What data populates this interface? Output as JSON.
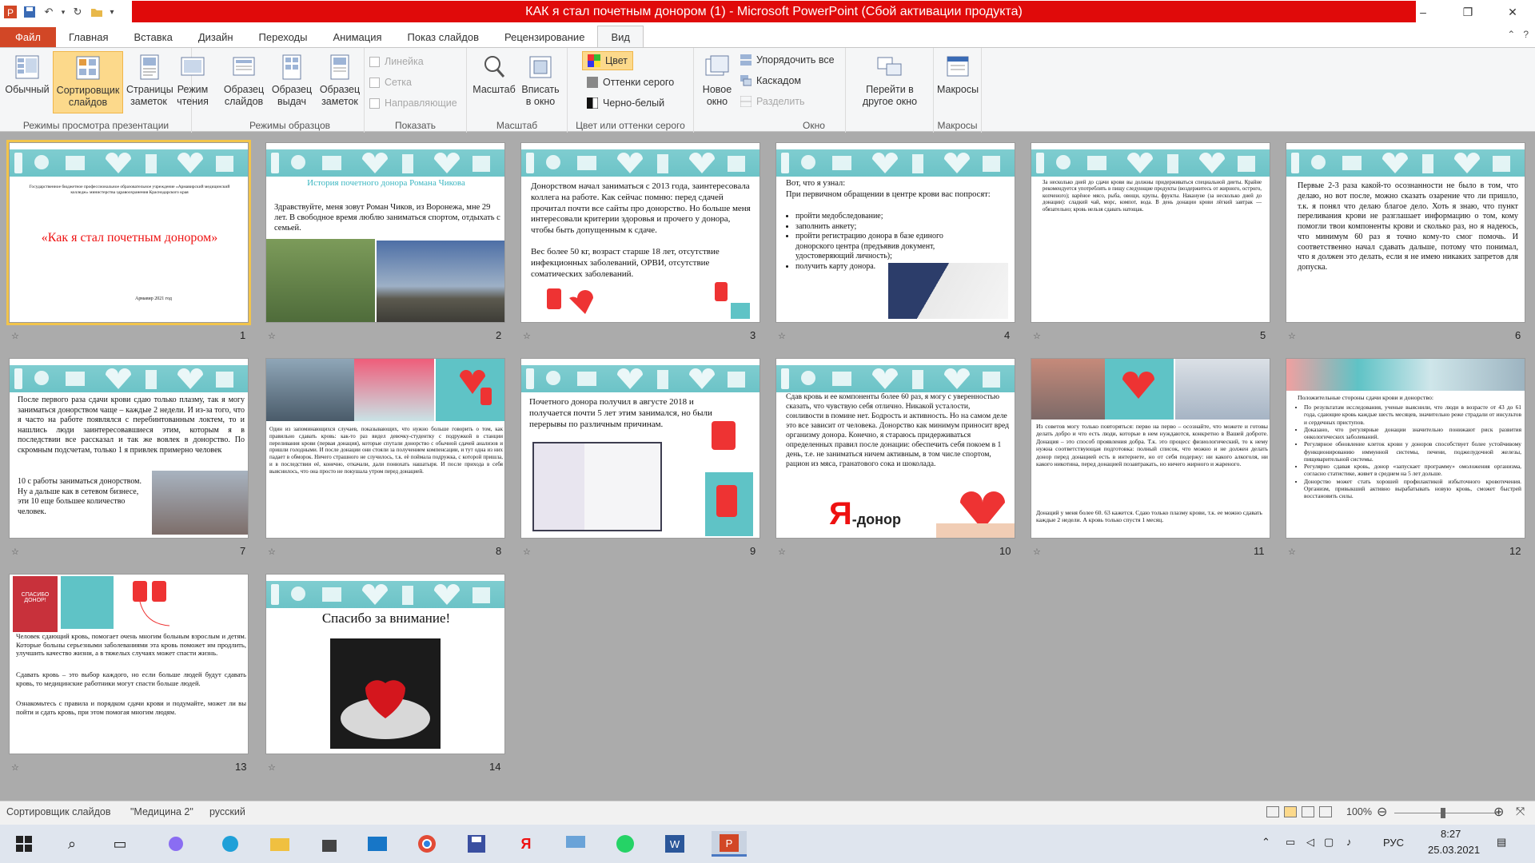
{
  "window": {
    "title": "КАК я стал почетным донором (1)  -  Microsoft PowerPoint (Сбой активации продукта)",
    "help": "?",
    "controls": [
      "–",
      "❐",
      "✕"
    ]
  },
  "tabs": [
    "Файл",
    "Главная",
    "Вставка",
    "Дизайн",
    "Переходы",
    "Анимация",
    "Показ слайдов",
    "Рецензирование",
    "Вид"
  ],
  "active_tab": "Вид",
  "ribbon": {
    "views": {
      "label": "Режимы просмотра презентации",
      "buttons": [
        "Обычный",
        "Сортировщик слайдов",
        "Страницы заметок",
        "Режим чтения"
      ]
    },
    "masters": {
      "label": "Режимы образцов",
      "buttons": [
        "Образец слайдов",
        "Образец выдач",
        "Образец заметок"
      ]
    },
    "show": {
      "label": "Показать",
      "items": [
        "Линейка",
        "Сетка",
        "Направляющие"
      ]
    },
    "zoom": {
      "label": "Масштаб",
      "buttons": [
        "Масштаб",
        "Вписать в окно"
      ]
    },
    "color": {
      "label": "Цвет или оттенки серого",
      "items": [
        "Цвет",
        "Оттенки серого",
        "Черно-белый"
      ]
    },
    "window": {
      "label": "Окно",
      "new_window": "Новое окно",
      "items": [
        "Упорядочить все",
        "Каскадом",
        "Разделить"
      ],
      "switch": "Перейти в другое окно"
    },
    "macros": {
      "label": "Макросы",
      "button": "Макросы"
    }
  },
  "slides": [
    {
      "num": "1",
      "small": "Государственное бюджетное профессиональное образовательное учреждение «Армавирский медицинский колледж» министерства здравоохранения Краснодарского края",
      "title": "«Как я стал почетным донором»",
      "footer": "Армавир 2021 год"
    },
    {
      "num": "2",
      "title": "История почетного донора Романа Чикова",
      "text": "Здравствуйте, меня зовут Роман Чиков, из Воронежа, мне 29 лет. В свободное время люблю заниматься спортом, отдыхать  с семьей."
    },
    {
      "num": "3",
      "text": "Донорством начал заниматься с 2013 года, заинтересовала коллега на работе. Как сейчас помню: перед сдачей прочитал почти все сайты про донорство. Но больше меня интересовали критерии здоровья и прочего у донора, чтобы быть допущенным к сдаче.",
      "text2": "Вес более 50 кг, возраст старше 18 лет, отсутствие инфекционных заболеваний, ОРВИ, отсутствие соматических заболеваний."
    },
    {
      "num": "4",
      "intro": "Вот, что я узнал:",
      "intro2": "При первичном обращении в центре крови вас попросят:",
      "bullets": [
        "пройти медобследование;",
        "заполнить анкету;",
        "пройти регистрацию донора в базе единого донорского центра (предъявив документ, удостоверяющий личность);",
        "получить карту донора."
      ]
    },
    {
      "num": "5",
      "text": "За несколько дней до сдачи крови вы должны придерживаться специальной диеты. Крайне рекомендуется употреблять в пищу следующие продукты (воздержитесь от жирного, острого, копченого); варёное мясо, рыба, овощи, крупы, фрукты.  Накануне (за несколько дней до донации): сладкий чай, морс, компот, вода.  В день донации крови лёгкий завтрак — обязательно; кровь нельзя сдавать натощак."
    },
    {
      "num": "6",
      "text": "Первые 2-3 раза какой-то осознанности не было в том, что делаю, но вот после, можно сказать озарение что ли пришло, т.к. я понял что делаю благое дело. Хоть я знаю, что пункт переливания крови не разглашает информацию о том, кому помогли твои компоненты крови и сколько раз, но я надеюсь, что минимум 60 раз я точно кому-то смог помочь. И соответственно начал сдавать дальше, потому что понимал, что я должен это делать, если я не имею никаких запретов для допуска."
    },
    {
      "num": "7",
      "text": "После первого раза сдачи крови сдаю только плазму, так я могу заниматься донорством чаще – каждые 2 недели. И из-за того, что я часто на работе появлялся с перебинтованным локтем, то и нашлись люди заинтересовавшиеся этим, которым я в последствии все рассказал и так же вовлек в донорство. По скромным подсчетам, только 1 я привлек примерно человек",
      "text2": "10 с работы заниматься донорством. Ну а дальше как в сетевом бизнесе, эти 10 еще большее количество человек."
    },
    {
      "num": "8",
      "text": "Один из запоминающихся случаев, показывающих, что нужно больше говорить о том, как правильно сдавать кровь: как-то раз видел девочку-студентку с подружкой в станции переливания крови (первая донация), которые спутали донорство с обычной сдачей анализов и пришли голодными. И после донации они стояли за получением компенсации, и тут одна из них падает в обморок. Ничего страшного не случилось, т.к. её поймала подружка, с которой пришла, и в последствии её, конечно, откачали, дали понюхать нашатыря. И после прихода в себя выяснилось, что она просто не покушала утром перед донацией."
    },
    {
      "num": "9",
      "text": "Почетного донора получил в августе 2018 и получается почти 5 лет этим занимался, но были перерывы по различным причинам."
    },
    {
      "num": "10",
      "text": "Сдав кровь и ее компоненты более 60 раз, я могу с уверенностью сказать, что чувствую себя отлично. Никакой усталости, сонливости в помине нет. Бодрость и активность. Но на самом деле это все зависит от человека. Донорство как минимум приносит вред организму донора. Конечно, я стараюсь придерживаться определенных правил после донации: обеспечить себя покоем в 1 день, т.е. не заниматься ничем активным, в том числе спортом, рацион из мяса, гранатового сока и шоколада.",
      "logo_ya": "Я",
      "logo_donor": "-донор"
    },
    {
      "num": "11",
      "text": "Из советов могу только повторяться: перво на перво – осознайте, что можете и готовы делать добро и что есть люди, которые в нем нуждаются, конкретно в Вашей доброте. Донация – это способ проявления добра. Т.к. это процесс физиологический, то к нему нужна соответствующая подготовка: полный список, что можно и не должен делать донор перед донацией есть в интернете, но от себя подержу: ни какого алкоголя, ни какого никотина, перед донацией позавтракать, но ничего жирного и жареного.",
      "text2": "Донаций у меня более 60. 63 кажется. Сдаю только плазму крови, т.к. ее можно сдавать каждые 2 недели. А кровь только спустя 1 месяц."
    },
    {
      "num": "12",
      "intro": "Положительные стороны сдачи крови и донорство:",
      "bullets": [
        "По результатам исследования, ученые выяснили, что люди в возрасте от 43 до 61 года, сдающие кровь каждые шесть месяцев, значительно реже страдали от инсультов и сердечных приступов.",
        "Доказано, что регулярные донации значительно понижают риск развития онкологических заболеваний.",
        "Регулярное обновление клеток крови у доноров способствует более устойчивому функционированию иммунной системы, печени, поджелудочной железы, пищеварительной системы.",
        "Регулярно сдавая кровь, донор «запускает программу» омоложения организма, согласно статистике, живет в среднем на 5 лет дольше.",
        "Донорство может стать хорошей профилактикой избыточного кровотечения. Организм, привыкший активно вырабатывать новую кровь, сможет быстрей восстановить силы."
      ]
    },
    {
      "num": "13",
      "text": "Человек сдающий кровь, помогает очень многим больным взрослым и детям. Которые больны серьезными заболеваниями эта кровь поможет им продлить, улучшить качество жизни, а в тяжелых случаях может спасти жизнь.",
      "text2": "Сдавать кровь – это выбор каждого, но если больше людей будут сдавать кровь, то медицинские работники могут спасти больше людей.",
      "text3": "Ознакомьтесь с правила и порядком сдачи крови и подумайте, может ли вы пойти и сдать кровь, при этом помогая многим людям.",
      "badge": "СПАСИБО ДОНОР!"
    },
    {
      "num": "14",
      "title": "Спасибо за внимание!"
    }
  ],
  "status": {
    "view": "Сортировщик слайдов",
    "theme": "\"Медицина 2\"",
    "lang": "русский",
    "zoom": "100%"
  },
  "taskbar": {
    "time": "8:27",
    "date": "25.03.2021",
    "lang": "РУС"
  },
  "colors": {
    "banner": "#6cc3c7",
    "title_red": "#e00a0a",
    "file_tab": "#d24726",
    "selected": "#fcd98b"
  }
}
